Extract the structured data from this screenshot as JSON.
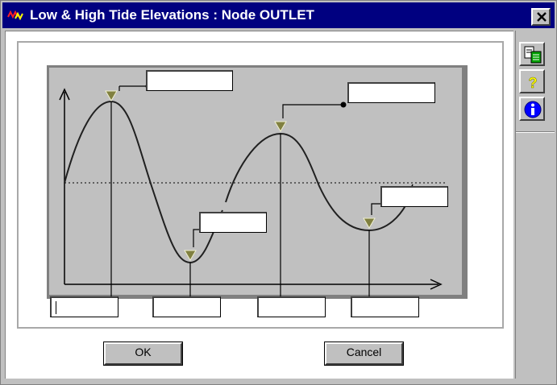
{
  "window": {
    "title": "Low & High Tide Elevations : Node OUTLET"
  },
  "buttons": {
    "ok_label": "OK",
    "cancel_label": "Cancel"
  },
  "elevation_fields": [
    {
      "name": "high-tide-1",
      "value": ""
    },
    {
      "name": "low-tide-1",
      "value": ""
    },
    {
      "name": "high-tide-2",
      "value": ""
    },
    {
      "name": "low-tide-2",
      "value": ""
    }
  ],
  "time_fields": [
    {
      "name": "time-1",
      "value": ""
    },
    {
      "name": "time-2",
      "value": ""
    },
    {
      "name": "time-3",
      "value": ""
    },
    {
      "name": "time-4",
      "value": ""
    }
  ],
  "sidebar": {
    "icons": [
      "copy-icon",
      "help-icon",
      "info-icon"
    ]
  },
  "colors": {
    "titlebar": "#000080",
    "plot_bg": "#c0c0c0",
    "marker": "#808040"
  }
}
